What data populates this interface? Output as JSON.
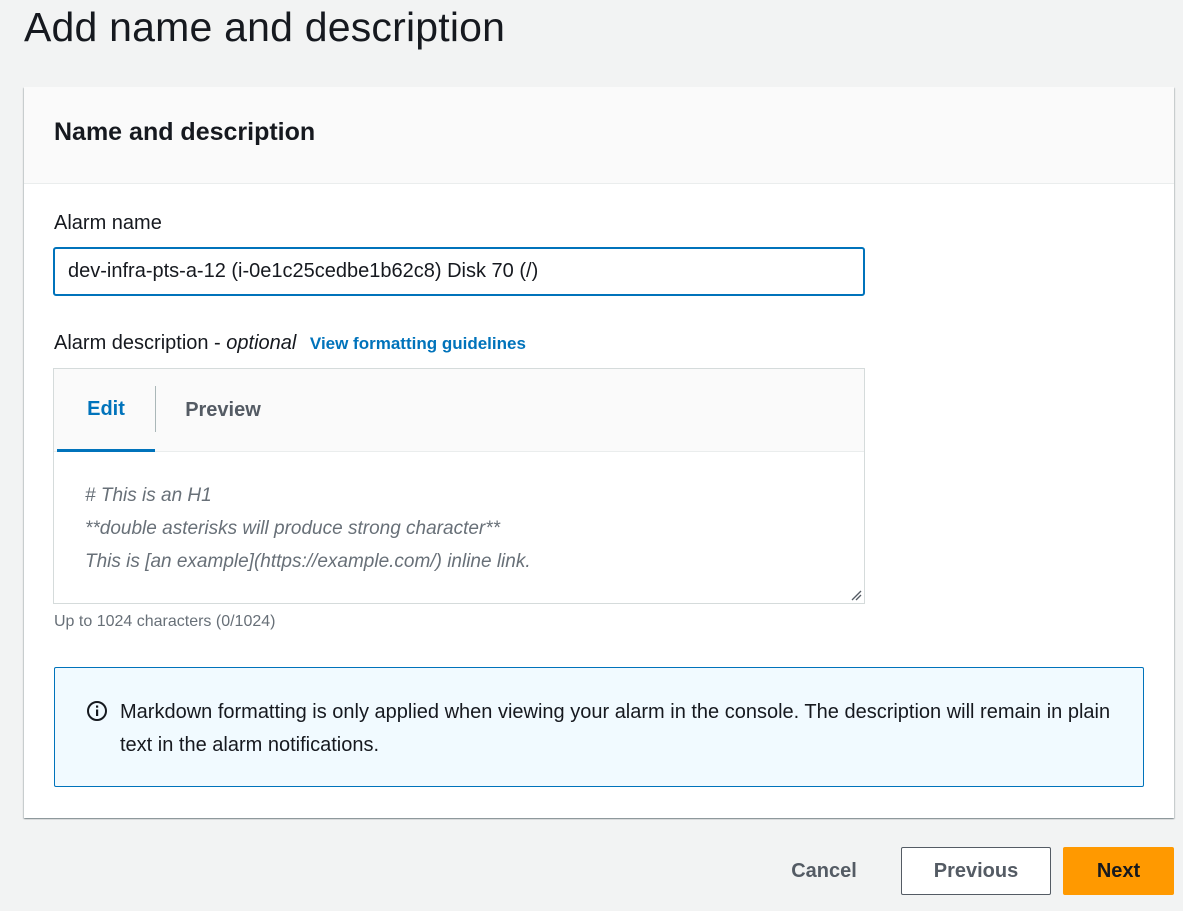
{
  "page": {
    "title": "Add name and description"
  },
  "section": {
    "title": "Name and description"
  },
  "alarm_name": {
    "label": "Alarm name",
    "value": "dev-infra-pts-a-12 (i-0e1c25cedbe1b62c8) Disk 70 (/)"
  },
  "alarm_description": {
    "label": "Alarm description - ",
    "optional": "optional",
    "guidelines_link": "View formatting guidelines",
    "tabs": {
      "edit": "Edit",
      "preview": "Preview"
    },
    "placeholder_lines": [
      "# This is an H1",
      "**double asterisks will produce strong character**",
      "This is [an example](https://example.com/) inline link."
    ],
    "value": "",
    "char_count": "Up to 1024 characters (0/1024)"
  },
  "info_alert": {
    "icon": "info-icon",
    "text": "Markdown formatting is only applied when viewing your alarm in the console. The description will remain in plain text in the alarm notifications."
  },
  "actions": {
    "cancel": "Cancel",
    "previous": "Previous",
    "next": "Next"
  },
  "colors": {
    "accent": "#0073bb",
    "primary_button": "#ff9900",
    "info_background": "#f1faff"
  }
}
